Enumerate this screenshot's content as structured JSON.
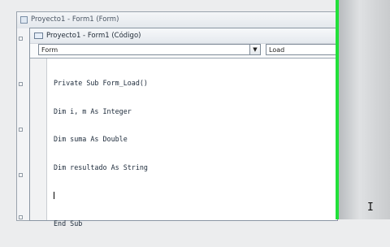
{
  "form_window": {
    "title": "Proyecto1 - Form1 (Form)"
  },
  "code_window": {
    "title": "Proyecto1 - Form1 (Código)",
    "object_combo": "Form",
    "procedure_combo": "Load",
    "code_lines": [
      "Private Sub Form_Load()",
      "Dim i, m As Integer",
      "Dim suma As Double",
      "Dim resultado As String",
      "",
      "End Sub"
    ]
  },
  "icons": {
    "form_icon": "form-window-icon",
    "code_icon": "code-window-icon",
    "dropdown": "chevron-down-icon",
    "cursor": "text-cursor-icon"
  },
  "colors": {
    "overlay_line": "#22e03a"
  }
}
